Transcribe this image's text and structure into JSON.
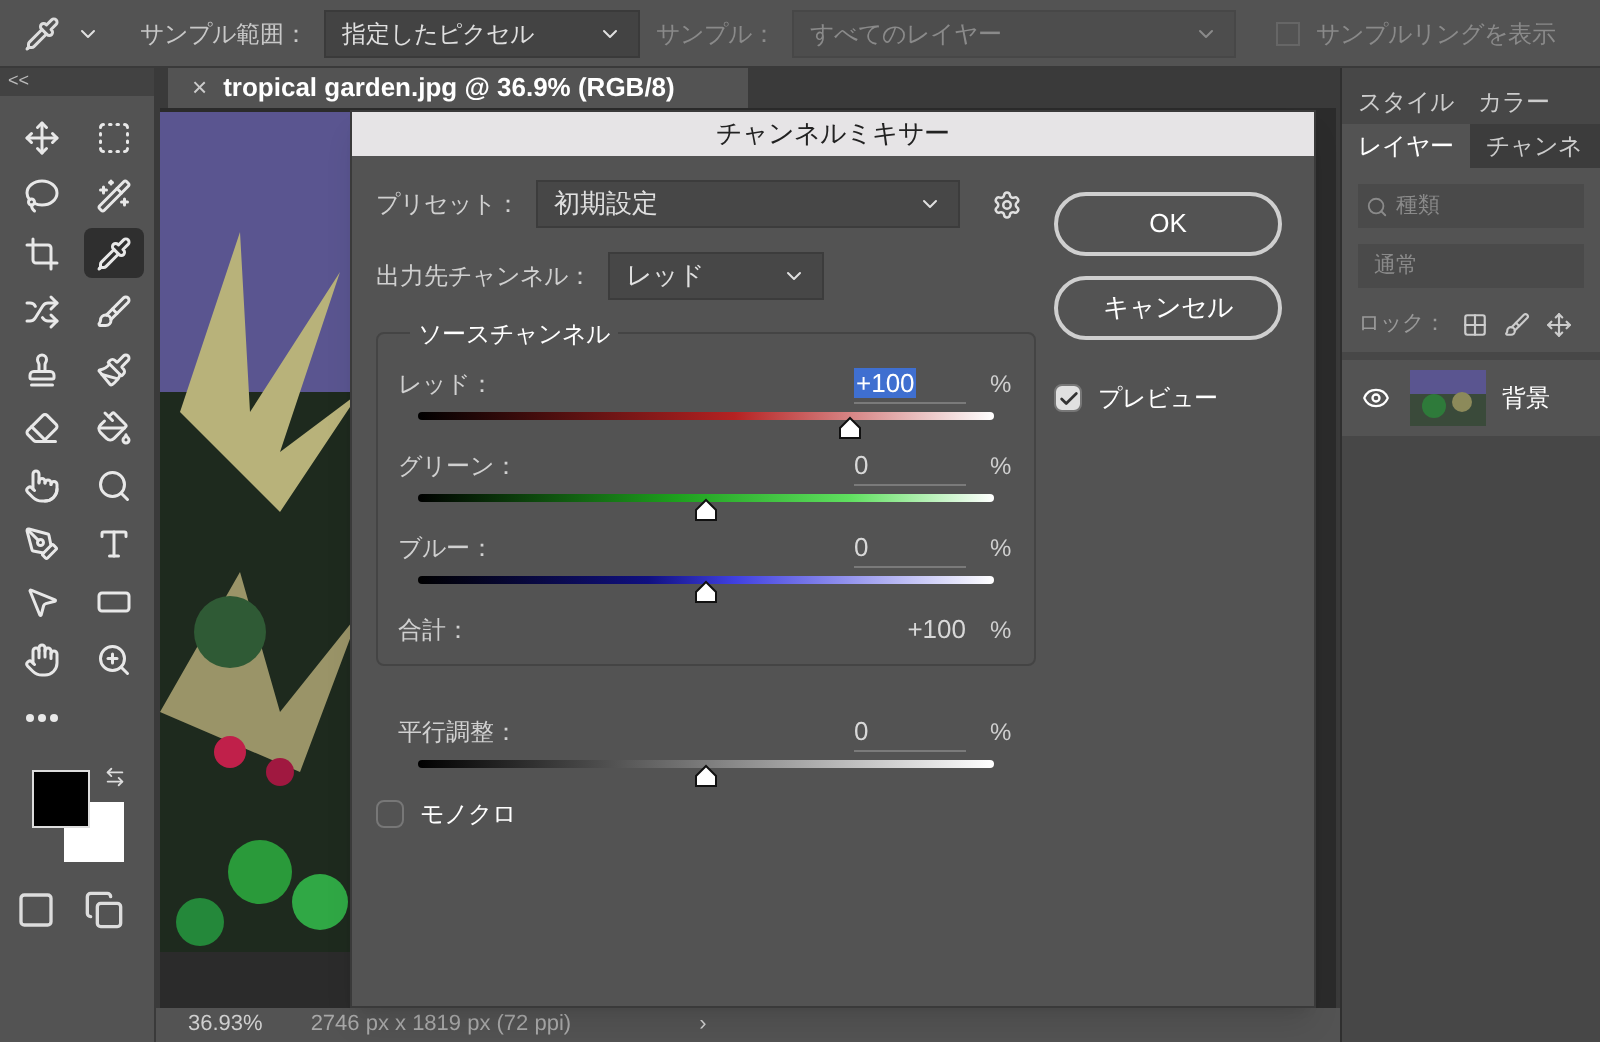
{
  "options_bar": {
    "sample_size_label": "サンプル範囲：",
    "sample_size_value": "指定したピクセル",
    "sample_label": "サンプル：",
    "sample_value": "すべてのレイヤー",
    "show_ring": {
      "label": "サンプルリングを表示",
      "checked": false
    }
  },
  "panel_collapse": "<<",
  "tools": [
    {
      "selected": false
    },
    {
      "selected": false
    },
    {
      "selected": false
    },
    {
      "selected": false
    },
    {
      "selected": false
    },
    {
      "selected": true
    },
    {
      "selected": false
    },
    {
      "selected": false
    },
    {
      "selected": false
    },
    {
      "selected": false
    },
    {
      "selected": false
    },
    {
      "selected": false
    },
    {
      "selected": false
    },
    {
      "selected": false
    },
    {
      "selected": false
    },
    {
      "selected": false
    },
    {
      "selected": false
    },
    {
      "selected": false
    },
    {
      "selected": false
    },
    {
      "selected": false
    },
    {
      "selected": false
    }
  ],
  "document_tab": {
    "close": "×",
    "title": "tropical garden.jpg @ 36.9% (RGB/8)"
  },
  "status_bar": {
    "zoom": "36.93%",
    "size": "2746 px x 1819 px (72 ppi)",
    "arrow": "›"
  },
  "right_panel": {
    "top_tabs": [
      {
        "label": "スタイル",
        "selected": false
      },
      {
        "label": "カラー",
        "selected": false
      }
    ],
    "tabs": [
      {
        "label": "レイヤー",
        "selected": true
      },
      {
        "label": "チャンネ",
        "selected": false
      }
    ],
    "filter_placeholder": "種類",
    "blend_mode": "通常",
    "lock_label": "ロック：",
    "layers": [
      {
        "name": "背景",
        "visible": true
      }
    ]
  },
  "dialog": {
    "title": "チャンネルミキサー",
    "preset_label": "プリセット：",
    "preset_value": "初期設定",
    "output_label": "出力先チャンネル：",
    "output_value": "レッド",
    "group_title": "ソースチャンネル",
    "channels": [
      {
        "kind": "red",
        "name": "レッド：",
        "value": "+100",
        "unit": "%",
        "level": 0.75,
        "selected": true
      },
      {
        "kind": "green",
        "name": "グリーン：",
        "value": "0",
        "unit": "%",
        "level": 0.5,
        "selected": false
      },
      {
        "kind": "blue",
        "name": "ブルー：",
        "value": "0",
        "unit": "%",
        "level": 0.5,
        "selected": false
      }
    ],
    "total": {
      "label": "合計：",
      "value": "+100",
      "unit": "%"
    },
    "constant": {
      "kind": "gray",
      "name": "平行調整：",
      "value": "0",
      "unit": "%",
      "level": 0.5,
      "selected": false
    },
    "monochrome": {
      "label": "モノクロ",
      "checked": false
    },
    "buttons": [
      "OK",
      "キャンセル"
    ],
    "preview": {
      "label": "プレビュー",
      "checked": true
    }
  }
}
